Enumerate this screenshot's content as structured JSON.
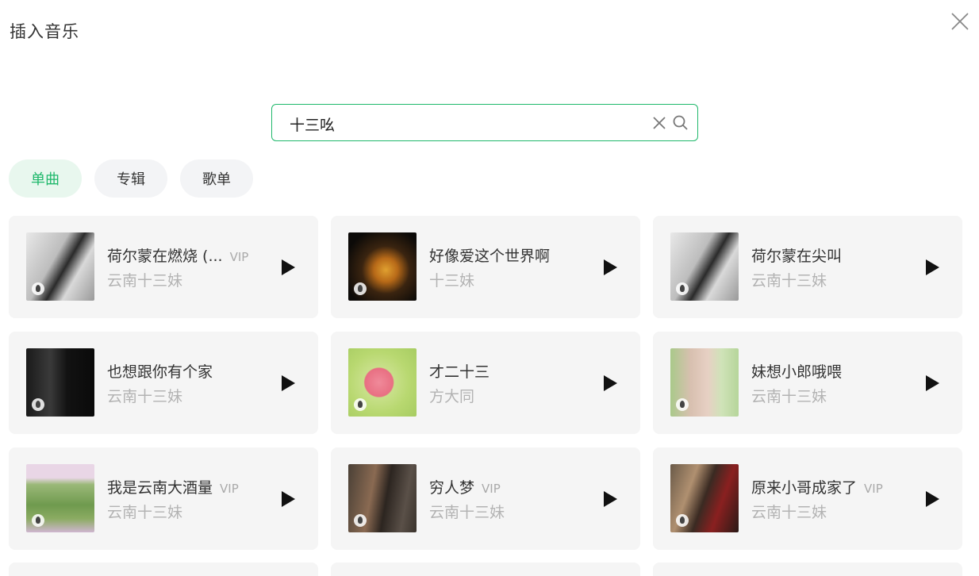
{
  "dialog": {
    "title": "插入音乐"
  },
  "search": {
    "value": "十三吆",
    "placeholder": ""
  },
  "tabs": [
    {
      "label": "单曲",
      "active": true
    },
    {
      "label": "专辑",
      "active": false
    },
    {
      "label": "歌单",
      "active": false
    }
  ],
  "songs": [
    {
      "title": "荷尔蒙在燃烧 (...",
      "vip": "VIP",
      "artist": "云南十三妹",
      "cover": "bw-portrait"
    },
    {
      "title": "好像爱这个世界啊",
      "vip": "",
      "artist": "十三妹",
      "cover": "night-portrait"
    },
    {
      "title": "荷尔蒙在尖叫",
      "vip": "",
      "artist": "云南十三妹",
      "cover": "bw-portrait"
    },
    {
      "title": "也想跟你有个家",
      "vip": "",
      "artist": "云南十三妹",
      "cover": "dark-calligraphy"
    },
    {
      "title": "才二十三",
      "vip": "",
      "artist": "方大同",
      "cover": "illustration-green"
    },
    {
      "title": "妹想小郎哦喂",
      "vip": "",
      "artist": "云南十三妹",
      "cover": "green-portrait"
    },
    {
      "title": "我是云南大酒量",
      "vip": "VIP",
      "artist": "云南十三妹",
      "cover": "rice-terrace"
    },
    {
      "title": "穷人梦",
      "vip": "VIP",
      "artist": "云南十三妹",
      "cover": "dark-sitting"
    },
    {
      "title": "原来小哥成家了",
      "vip": "VIP",
      "artist": "云南十三妹",
      "cover": "red-dress"
    }
  ],
  "colors": {
    "accent": "#1fb86b",
    "card_bg": "#f5f5f5",
    "tab_bg": "#f3f4f6",
    "tab_active_bg": "#e8f7ee"
  },
  "icons": {
    "close": "close-icon",
    "clear": "clear-icon",
    "search": "search-icon",
    "play": "play-icon"
  }
}
